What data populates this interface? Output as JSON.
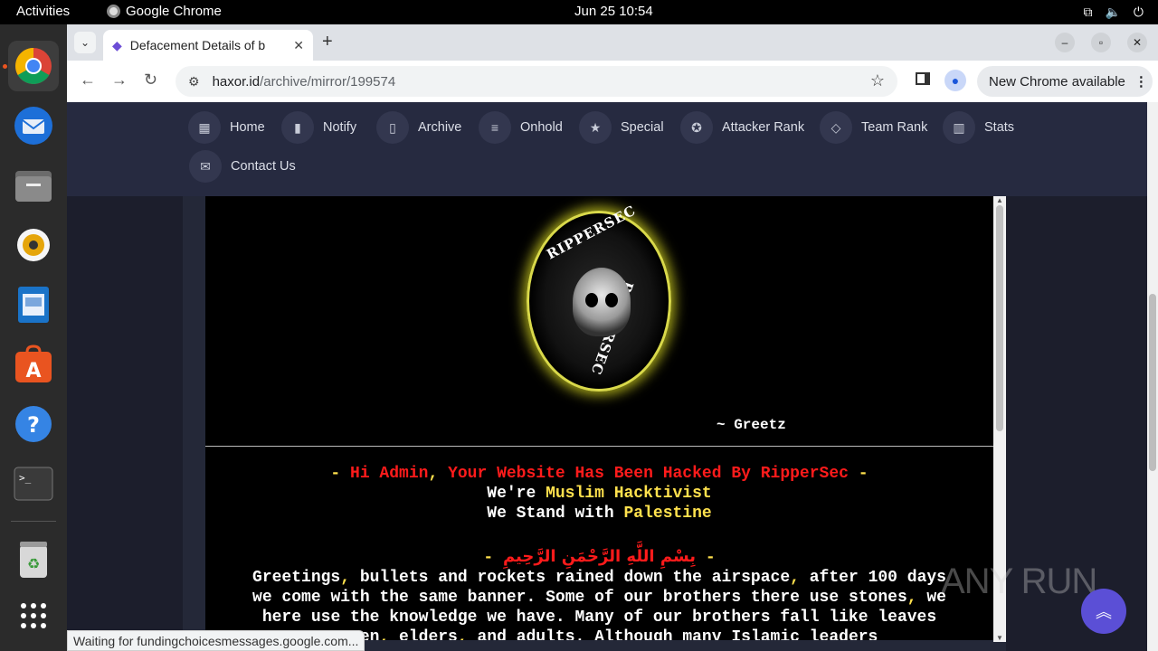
{
  "system": {
    "activities": "Activities",
    "app_name": "Google Chrome",
    "clock": "Jun 25  10:54"
  },
  "dock": {
    "items": [
      "chrome-icon",
      "thunderbird-icon",
      "files-icon",
      "rhythmbox-icon",
      "writer-icon",
      "app-center-icon",
      "help-icon",
      "terminal-icon",
      "trash-icon",
      "app-grid-icon"
    ]
  },
  "browser": {
    "tab_title": "Defacement Details of b",
    "url_host": "haxor.id",
    "url_path": "/archive/mirror/199574",
    "update_label": "New Chrome available",
    "status_text": "Waiting for fundingchoicesmessages.google.com..."
  },
  "site_nav": {
    "items": [
      {
        "label": "Home",
        "icon": "home-icon"
      },
      {
        "label": "Notify",
        "icon": "bookmark-icon"
      },
      {
        "label": "Archive",
        "icon": "archive-icon"
      },
      {
        "label": "Onhold",
        "icon": "document-icon"
      },
      {
        "label": "Special",
        "icon": "shield-star-icon"
      },
      {
        "label": "Attacker Rank",
        "icon": "badge-icon"
      },
      {
        "label": "Team Rank",
        "icon": "layers-icon"
      },
      {
        "label": "Stats",
        "icon": "chart-icon"
      },
      {
        "label": "Contact Us",
        "icon": "mail-icon"
      }
    ]
  },
  "mirror": {
    "logo_top_text": "RIPPERSEC",
    "logo_side_text": "RIPPERSEC",
    "greetz": "~ Greetz",
    "line1_dash_open": "- ",
    "line1_hi": "Hi Admin",
    "line1_comma": ",",
    "line1_rest": " Your Website Has Been Hacked By RipperSec",
    "line1_dash_close": " -",
    "line2_a": "We're ",
    "line2_b": "Muslim Hacktivist",
    "line3_a": "We Stand with ",
    "line3_b": "Palestine",
    "bismillah_dash_a": "- ",
    "bismillah": "بِسْمِ اللَّهِ الرَّحْمَنِ الرَّحِيمِ",
    "bismillah_dash_b": " -",
    "p1": "Greetings",
    "p2": " bullets and rockets rained down the airspace",
    "p3": " after 100 days",
    "p4": "we come with the same banner. Some of our brothers there use stones",
    "p5": " we",
    "p6": "here use the knowledge we have. Many of our brothers fall like leaves",
    "p7": "...ren",
    "p8": " elders",
    "p9": " and adults. Although many Islamic leaders"
  },
  "watermark": "ANY RUN"
}
